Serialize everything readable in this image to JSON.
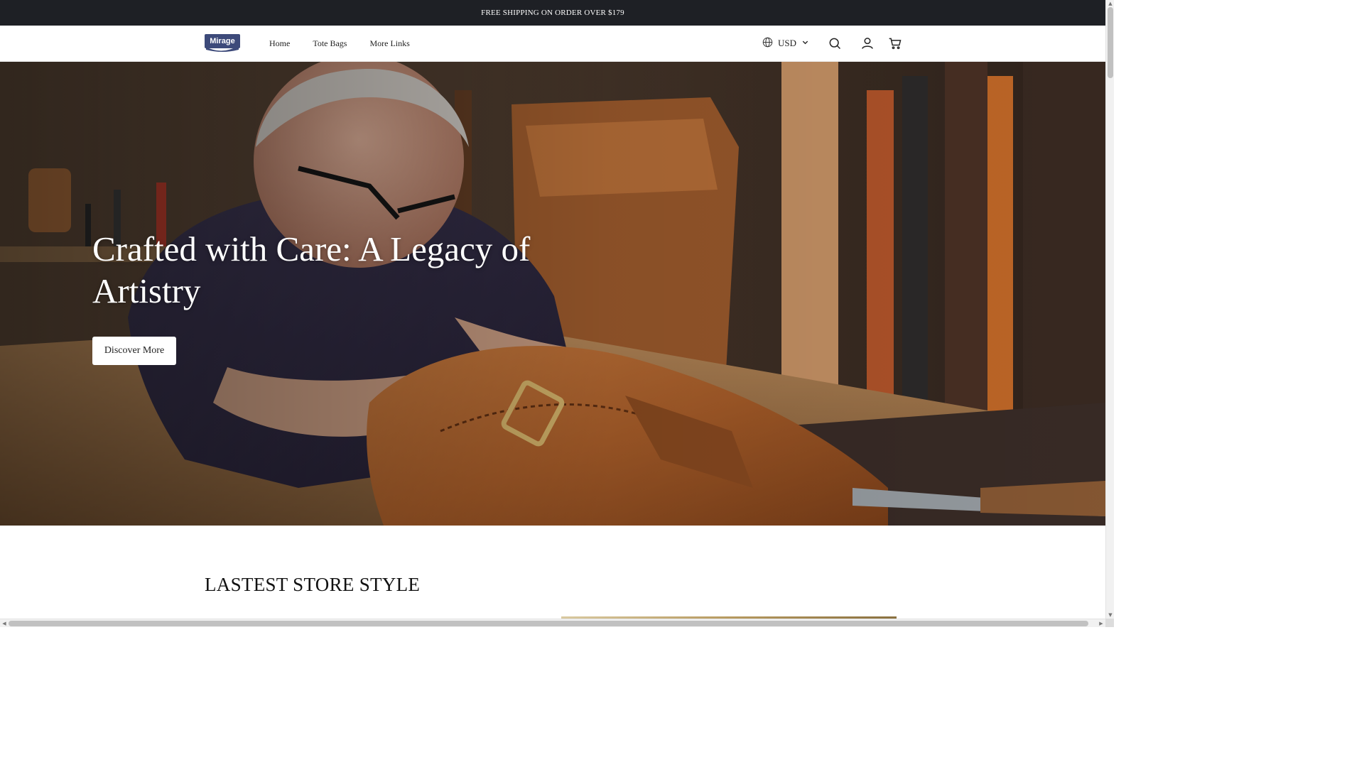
{
  "announcement": {
    "text": "FREE SHIPPING ON ORDER OVER $179"
  },
  "header": {
    "logo_text": "Mirage",
    "nav": [
      {
        "label": "Home"
      },
      {
        "label": "Tote Bags"
      },
      {
        "label": "More Links"
      }
    ],
    "currency": "USD",
    "icons": [
      "globe-icon",
      "chevron-down-icon",
      "search-icon",
      "account-icon",
      "cart-icon"
    ]
  },
  "hero": {
    "title": "Crafted with Care: A Legacy of Artistry",
    "button_label": "Discover More",
    "image": "craftsman-stitching-leather-bag-photo"
  },
  "section": {
    "title": "LASTEST STORE STYLE"
  },
  "colors": {
    "announce_bg": "#1e2025",
    "text": "#222222",
    "hero_button_bg": "#ffffff"
  }
}
